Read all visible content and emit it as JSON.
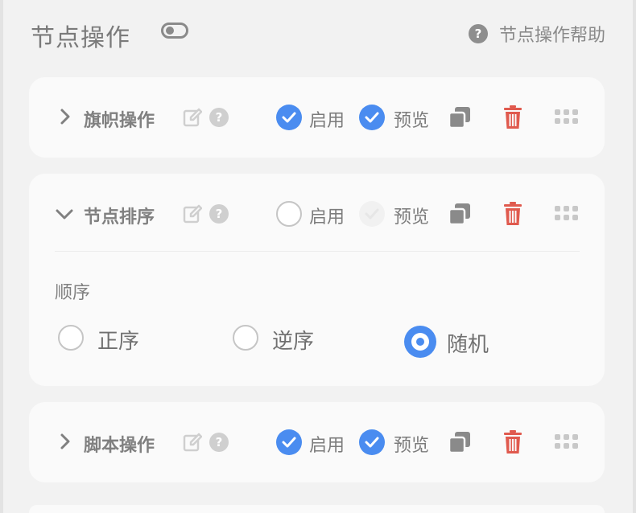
{
  "header": {
    "title": "节点操作",
    "help_label": "节点操作帮助"
  },
  "icons": {
    "help": "?"
  },
  "colors": {
    "accent": "#4a8cf0",
    "danger": "#e05a4e",
    "background": "#f2f2f2",
    "card": "#fafafa"
  },
  "cards": [
    {
      "title": "旗帜操作",
      "expanded": false,
      "enable_label": "启用",
      "enable_checked": true,
      "preview_label": "预览",
      "preview_checked": true
    },
    {
      "title": "节点排序",
      "expanded": true,
      "enable_label": "启用",
      "enable_checked": false,
      "preview_label": "预览",
      "preview_checked": false,
      "order": {
        "label": "顺序",
        "options": [
          "正序",
          "逆序",
          "随机"
        ],
        "selected": "随机"
      }
    },
    {
      "title": "脚本操作",
      "expanded": false,
      "enable_label": "启用",
      "enable_checked": true,
      "preview_label": "预览",
      "preview_checked": true
    }
  ]
}
